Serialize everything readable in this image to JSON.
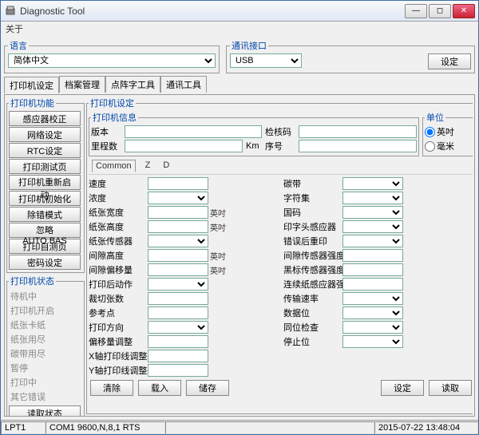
{
  "window": {
    "title": "Diagnostic Tool"
  },
  "menu": {
    "about": "关于"
  },
  "language": {
    "legend": "语言",
    "value": "简体中文"
  },
  "comm": {
    "legend": "通讯接口",
    "value": "USB",
    "set_btn": "设定"
  },
  "main_tabs": [
    "打印机设定",
    "档案管理",
    "点阵字工具",
    "通讯工具"
  ],
  "func": {
    "legend": "打印机功能",
    "buttons": [
      "感应器校正",
      "网络设定",
      "RTC设定",
      "打印测试页",
      "打印机重新启动",
      "打印机初始化",
      "除错模式",
      "忽略 AUTO.BAS",
      "打印自测页",
      "密码设定"
    ]
  },
  "status": {
    "legend": "打印机状态",
    "items": [
      "待机中",
      "打印机开启",
      "纸张卡纸",
      "纸张用尽",
      "碳带用尽",
      "暂停",
      "打印中",
      "其它错误"
    ],
    "read_btn": "读取状态"
  },
  "settings": {
    "legend": "打印机设定",
    "info": {
      "legend": "打印机信息",
      "version": "版本",
      "version_val": "",
      "checksum": "检核码",
      "checksum_val": "",
      "mileage": "里程数",
      "mileage_val": "",
      "mileage_unit": "Km",
      "serial": "序号",
      "serial_val": ""
    },
    "unit": {
      "legend": "单位",
      "inch": "英吋",
      "mm": "毫米",
      "selected": "inch"
    },
    "subtabs": [
      "Common",
      "Z",
      "D"
    ],
    "left_params": [
      {
        "label": "速度",
        "type": "text"
      },
      {
        "label": "浓度",
        "type": "select"
      },
      {
        "label": "纸张宽度",
        "type": "text",
        "unit": "英吋"
      },
      {
        "label": "纸张高度",
        "type": "text",
        "unit": "英吋"
      },
      {
        "label": "纸张传感器",
        "type": "select"
      },
      {
        "label": "间隙高度",
        "type": "text",
        "unit": "英吋"
      },
      {
        "label": "间隙偏移量",
        "type": "text",
        "unit": "英吋"
      },
      {
        "label": "打印后动作",
        "type": "select"
      },
      {
        "label": "裁切张数",
        "type": "text"
      },
      {
        "label": "参考点",
        "type": "text"
      },
      {
        "label": "打印方向",
        "type": "select"
      },
      {
        "label": "偏移量调整",
        "type": "text"
      },
      {
        "label": "X轴打印线调整",
        "type": "text"
      },
      {
        "label": "Y轴打印线调整",
        "type": "text"
      }
    ],
    "right_params": [
      {
        "label": "碳带",
        "type": "select"
      },
      {
        "label": "字符集",
        "type": "select"
      },
      {
        "label": "国码",
        "type": "select"
      },
      {
        "label": "印字头感应器",
        "type": "select"
      },
      {
        "label": "错误后重印",
        "type": "select"
      },
      {
        "label": "间隙传感器强度",
        "type": "text"
      },
      {
        "label": "黑标传感器强度",
        "type": "text"
      },
      {
        "label": "连续纸感应器强度",
        "type": "text"
      },
      {
        "label": "传输速率",
        "type": "select"
      },
      {
        "label": "数据位",
        "type": "select"
      },
      {
        "label": "同位检查",
        "type": "select"
      },
      {
        "label": "停止位",
        "type": "select"
      }
    ],
    "bottom_buttons": {
      "clear": "清除",
      "load": "载入",
      "save": "储存",
      "set": "设定",
      "read": "读取"
    }
  },
  "statusbar": {
    "port1": "LPT1",
    "port2": "COM1 9600,N,8,1 RTS",
    "datetime": "2015-07-22 13:48:04"
  }
}
